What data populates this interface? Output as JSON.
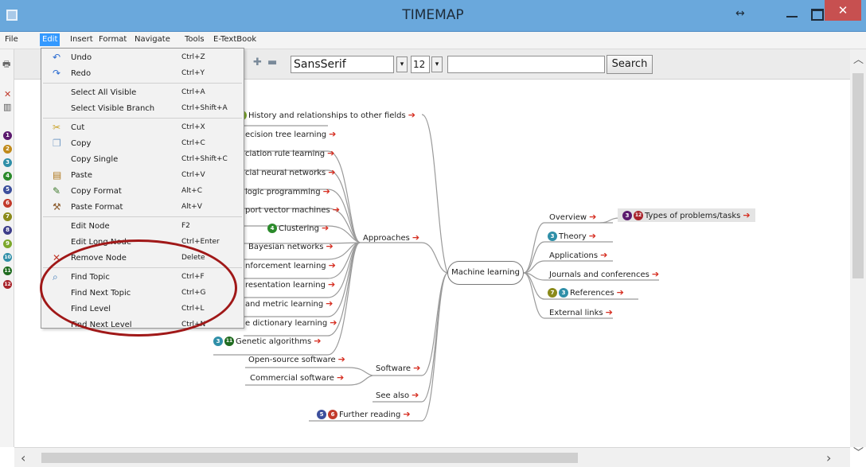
{
  "window": {
    "title": "TIMEMAP"
  },
  "menubar": {
    "items": [
      "File",
      "Edit",
      "Insert",
      "Format",
      "Navigate",
      "Tools",
      "E-TextBook"
    ]
  },
  "toolbar": {
    "font": "SansSerif",
    "size": "12",
    "search_label": "Search",
    "search_value": ""
  },
  "sidebar": {
    "levels": [
      "1",
      "2",
      "3",
      "4",
      "5",
      "6",
      "7",
      "8",
      "9",
      "10",
      "11",
      "12"
    ]
  },
  "edit_menu": {
    "items": [
      {
        "label": "Undo",
        "shortcut": "Ctrl+Z",
        "icon": "undo-icon"
      },
      {
        "label": "Redo",
        "shortcut": "Ctrl+Y",
        "icon": "redo-icon"
      },
      {
        "label": "Select All Visible",
        "shortcut": "Ctrl+A"
      },
      {
        "label": "Select Visible Branch",
        "shortcut": "Ctrl+Shift+A"
      },
      {
        "label": "Cut",
        "shortcut": "Ctrl+X",
        "icon": "cut-icon"
      },
      {
        "label": "Copy",
        "shortcut": "Ctrl+C",
        "icon": "copy-icon"
      },
      {
        "label": "Copy Single",
        "shortcut": "Ctrl+Shift+C"
      },
      {
        "label": "Paste",
        "shortcut": "Ctrl+V",
        "icon": "paste-icon"
      },
      {
        "label": "Copy Format",
        "shortcut": "Alt+C",
        "icon": "brush-icon"
      },
      {
        "label": "Paste Format",
        "shortcut": "Alt+V",
        "icon": "paste-format-icon"
      },
      {
        "label": "Edit Node",
        "shortcut": "F2"
      },
      {
        "label": "Edit Long Node",
        "shortcut": "Ctrl+Enter"
      },
      {
        "label": "Remove Node",
        "shortcut": "Delete",
        "icon": "remove-icon"
      },
      {
        "label": "Find Topic",
        "shortcut": "Ctrl+F",
        "icon": "find-icon"
      },
      {
        "label": "Find Next Topic",
        "shortcut": "Ctrl+G"
      },
      {
        "label": "Find Level",
        "shortcut": "Ctrl+L"
      },
      {
        "label": "Find Next Level",
        "shortcut": "Ctrl+N"
      }
    ]
  },
  "mindmap": {
    "root": "Machine learning",
    "approaches_label": "Approaches",
    "software_label": "Software",
    "left_nodes": [
      "History and relationships to other fields",
      "ecision tree learning",
      "ciation rule learning",
      "cial neural networks",
      "logic programming",
      "port vector machines",
      "Clustering",
      "Bayesian networks",
      "nforcement learning",
      "resentation learning",
      "and metric learning",
      "e dictionary learning",
      "Genetic algorithms"
    ],
    "software_children": [
      "Open-source software",
      "Commercial software"
    ],
    "see_also": "See also",
    "further_reading": "Further reading",
    "right_nodes": [
      "Overview",
      "Theory",
      "Applications",
      "Journals and conferences",
      "References",
      "External links"
    ],
    "types_node": "Types of problems/tasks",
    "badges": {
      "history": "1",
      "clustering": "4",
      "genetic_a": "3",
      "genetic_b": "11",
      "further_a": "5",
      "further_b": "6",
      "theory": "3",
      "references_a": "7",
      "references_b": "3",
      "types_a": "3",
      "types_b": "12"
    }
  }
}
